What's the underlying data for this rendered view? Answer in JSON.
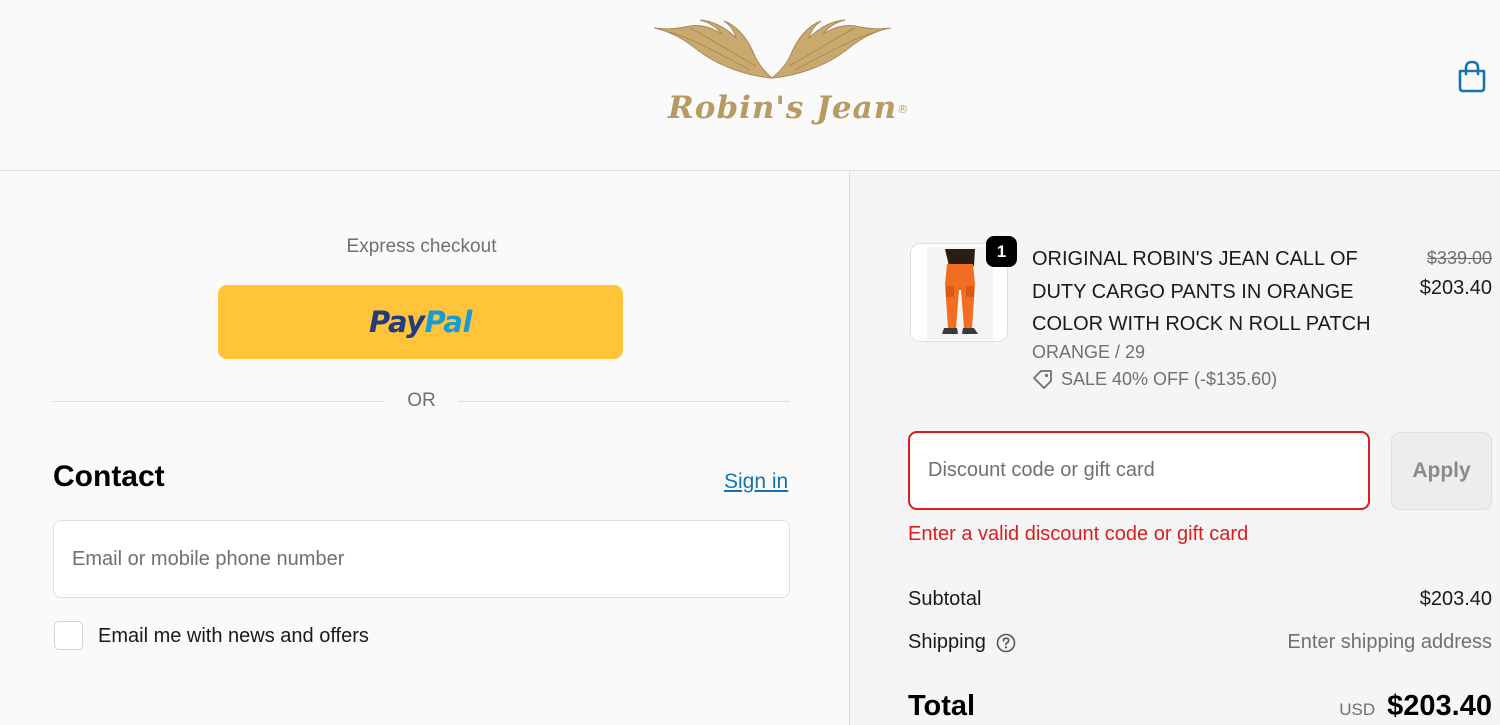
{
  "header": {
    "logo_text": "Robin's Jean",
    "logo_mark": "®",
    "cart_icon": "shopping-bag-icon",
    "accent_color": "#1773b0"
  },
  "express": {
    "label": "Express checkout",
    "paypal_pay": "Pay",
    "paypal_pal": "Pal",
    "or_label": "OR"
  },
  "contact": {
    "title": "Contact",
    "sign_in": "Sign in",
    "email_placeholder": "Email or mobile phone number",
    "news_label": "Email me with news and offers"
  },
  "order": {
    "product": {
      "quantity": "1",
      "name": "ORIGINAL ROBIN'S JEAN CALL OF DUTY CARGO PANTS IN ORANGE COLOR WITH ROCK N ROLL PATCH",
      "variant": "ORANGE / 29",
      "discount": "SALE 40% OFF (-$135.60)",
      "original_price": "$339.00",
      "sale_price": "$203.40"
    },
    "discount_placeholder": "Discount code or gift card",
    "apply_label": "Apply",
    "error_message": "Enter a valid discount code or gift card",
    "error_color": "#dd1d1d",
    "subtotal_label": "Subtotal",
    "subtotal_value": "$203.40",
    "shipping_label": "Shipping",
    "shipping_value": "Enter shipping address",
    "total_label": "Total",
    "currency": "USD",
    "total_value": "$203.40"
  }
}
